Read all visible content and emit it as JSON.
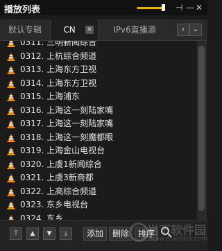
{
  "window": {
    "title": "播放列表"
  },
  "volume": {
    "level": 0.85,
    "accent_color": "#e0b800"
  },
  "titlebar_icons": [
    "pin-icon",
    "minimize-icon",
    "close-icon"
  ],
  "tabs": [
    {
      "label": "默认专辑",
      "active": false
    },
    {
      "label": "CN",
      "active": true
    },
    {
      "label": "IPv6直播源",
      "active": false
    }
  ],
  "playlist": {
    "items": [
      "0311. 三明新闻综合",
      "0312. 上杭综合频道",
      "0313. 上海东方卫视",
      "0314. 上海东方卫视",
      "0315. 上海浦东",
      "0316. 上海这一刻陆家嘴",
      "0317. 上海这一刻陆家嘴",
      "0318. 上海这一刻魔都眼",
      "0319. 上海金山电视台",
      "0320. 上虞1新闻综合",
      "0321. 上虞3新商都",
      "0322. 上高综合频道",
      "0323. 东乡电视台",
      "0324. 东乡..."
    ]
  },
  "footer": {
    "add_label": "添加",
    "delete_label": "删除",
    "sort_label": "排序"
  },
  "watermark": {
    "text": "当下软件园",
    "sub": "www.downxia.com"
  }
}
